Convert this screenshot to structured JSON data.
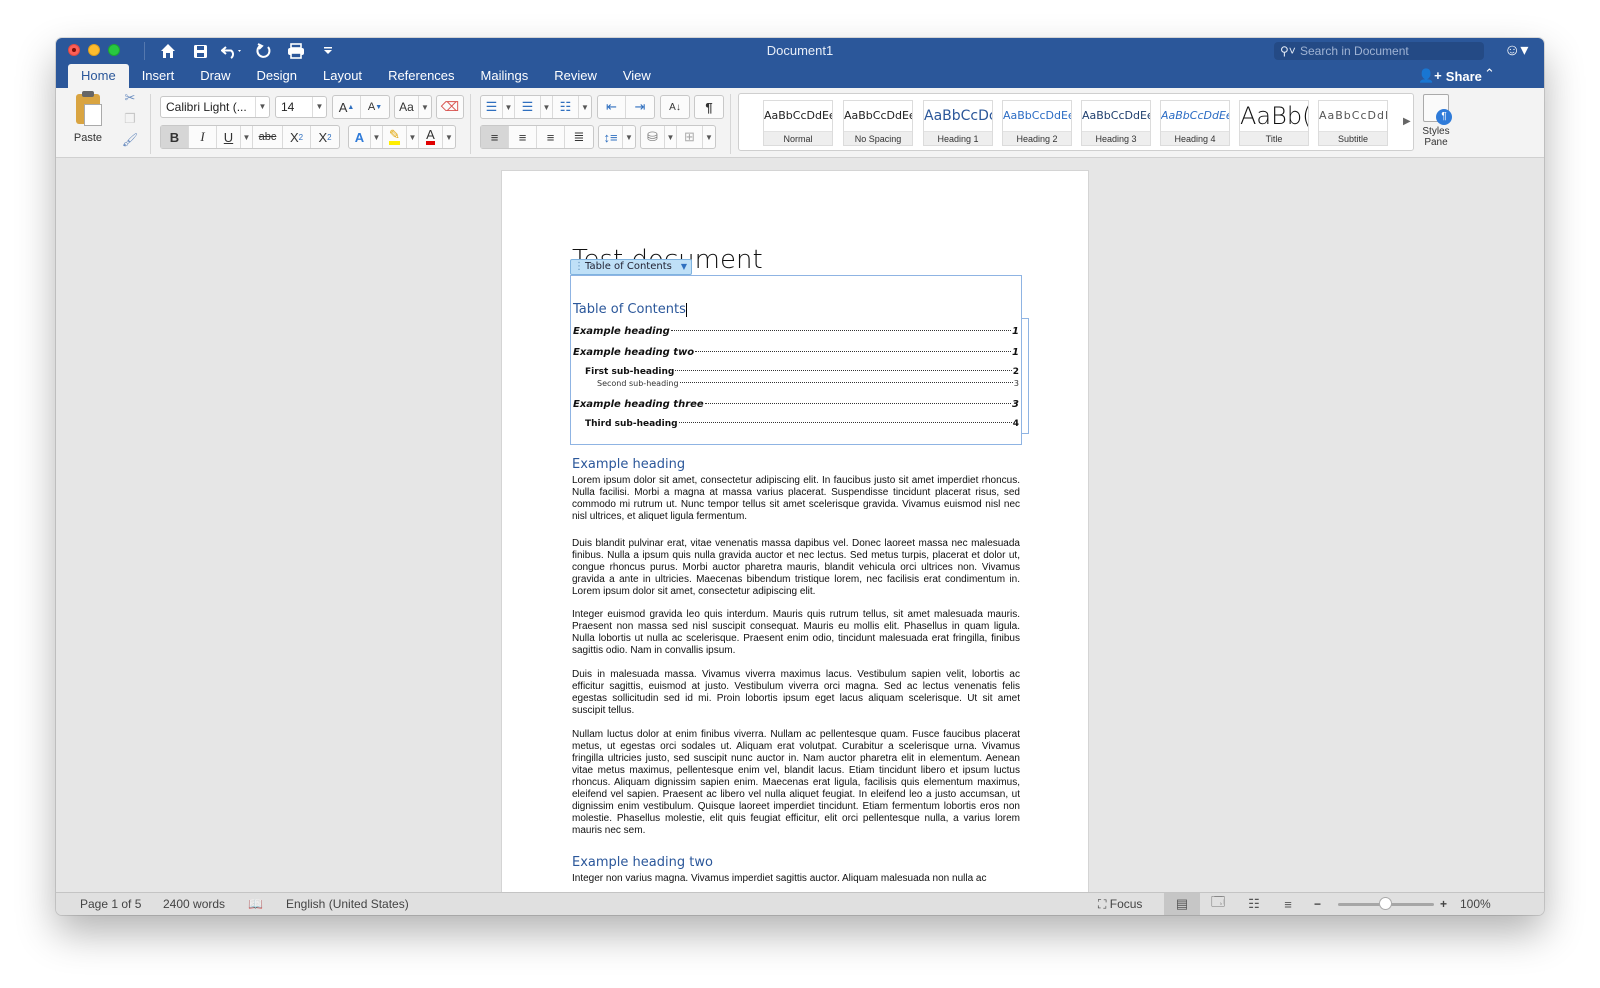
{
  "window": {
    "title": "Document1",
    "search_placeholder": "Search in Document"
  },
  "quick_access": [
    {
      "icon": "home-icon",
      "glyph": "⌂"
    },
    {
      "icon": "save-icon",
      "glyph": "💾"
    },
    {
      "icon": "undo-icon",
      "glyph": "↶"
    },
    {
      "icon": "redo-icon",
      "glyph": "↺"
    },
    {
      "icon": "print-icon",
      "glyph": "⎙"
    },
    {
      "icon": "customize-icon",
      "glyph": "▾"
    }
  ],
  "tabs": [
    {
      "label": "Home",
      "active": true
    },
    {
      "label": "Insert"
    },
    {
      "label": "Draw"
    },
    {
      "label": "Design"
    },
    {
      "label": "Layout"
    },
    {
      "label": "References"
    },
    {
      "label": "Mailings"
    },
    {
      "label": "Review"
    },
    {
      "label": "View"
    }
  ],
  "share_label": "Share",
  "ribbon": {
    "paste_label": "Paste",
    "font_name": "Calibri Light (...",
    "font_size": "14",
    "styles": [
      {
        "sample": "AaBbCcDdEe",
        "name": "Normal",
        "color": "#222222"
      },
      {
        "sample": "AaBbCcDdEe",
        "name": "No Spacing",
        "color": "#222222"
      },
      {
        "sample": "AaBbCcDc",
        "name": "Heading 1",
        "color": "#2b579a"
      },
      {
        "sample": "AaBbCcDdEe",
        "name": "Heading 2",
        "color": "#2b6cc4"
      },
      {
        "sample": "AaBbCcDdEe",
        "name": "Heading 3",
        "color": "#1f3f6e"
      },
      {
        "sample": "AaBbCcDdEe",
        "name": "Heading 4",
        "color": "#2b6cc4"
      },
      {
        "sample": "AaBb(",
        "name": "Title",
        "color": "#111111"
      },
      {
        "sample": "AaBbCcDdEe",
        "name": "Subtitle",
        "color": "#555555"
      }
    ],
    "styles_pane_label_1": "Styles",
    "styles_pane_label_2": "Pane"
  },
  "document": {
    "title": "Test document",
    "toc_control_label": "Table of Contents",
    "toc_heading": "Table of Contents",
    "toc_entries": [
      {
        "text": "Example heading",
        "page": "1",
        "level": 1
      },
      {
        "text": "Example heading two",
        "page": "1",
        "level": 1
      },
      {
        "text": "First sub-heading",
        "page": "2",
        "level": 2
      },
      {
        "text": "Second sub-heading",
        "page": "3",
        "level": 3
      },
      {
        "text": "Example heading three",
        "page": "3",
        "level": 1
      },
      {
        "text": "Third sub-heading",
        "page": "4",
        "level": 2
      }
    ],
    "heading_1": "Example heading",
    "paragraphs": [
      "Lorem ipsum dolor sit amet, consectetur adipiscing elit. In faucibus justo sit amet imperdiet rhoncus. Nulla facilisi. Morbi a magna at massa varius placerat. Suspendisse tincidunt placerat risus, sed commodo mi rutrum ut. Nunc tempor tellus sit amet scelerisque gravida. Vivamus euismod nisl nec nisl ultrices, et aliquet ligula fermentum.",
      "Duis blandit pulvinar erat, vitae venenatis massa dapibus vel. Donec laoreet massa nec malesuada finibus. Nulla a ipsum quis nulla gravida auctor et nec lectus. Sed metus turpis, placerat et dolor ut, congue rhoncus purus. Morbi auctor pharetra mauris, blandit vehicula orci ultrices non. Vivamus gravida a ante in ultricies. Maecenas bibendum tristique lorem, nec facilisis erat condimentum in. Lorem ipsum dolor sit amet, consectetur adipiscing elit.",
      "Integer euismod gravida leo quis interdum. Mauris quis rutrum tellus, sit amet malesuada mauris. Praesent non massa sed nisl suscipit consequat. Mauris eu mollis elit. Phasellus in quam ligula. Nulla lobortis ut nulla ac scelerisque. Praesent enim odio, tincidunt malesuada erat fringilla, finibus sagittis odio. Nam in convallis ipsum.",
      "Duis in malesuada massa. Vivamus viverra maximus lacus. Vestibulum sapien velit, lobortis ac efficitur sagittis, euismod at justo. Vestibulum viverra orci magna. Sed ac lectus venenatis felis egestas sollicitudin sed id mi. Proin lobortis ipsum eget lacus aliquam scelerisque. Ut sit amet suscipit tellus.",
      "Nullam luctus dolor at enim finibus viverra. Nullam ac pellentesque quam. Fusce faucibus placerat metus, ut egestas orci sodales ut. Aliquam erat volutpat. Curabitur a scelerisque urna. Vivamus fringilla ultricies justo, sed suscipit nunc auctor in. Nam auctor pharetra elit in elementum. Aenean vitae metus maximus, pellentesque enim vel, blandit lacus. Etiam tincidunt libero et ipsum luctus rhoncus. Aliquam dignissim sapien enim. Maecenas erat ligula, facilisis quis elementum maximus, eleifend vel sapien. Praesent ac libero vel nulla aliquet feugiat. In eleifend leo a justo accumsan, ut dignissim enim vestibulum. Quisque laoreet imperdiet tincidunt. Etiam fermentum lobortis eros non molestie. Phasellus molestie, elit quis feugiat efficitur, elit orci pellentesque nulla, a varius lorem mauris nec sem."
    ],
    "heading_2": "Example heading two",
    "paragraph_cut": "Integer non varius magna. Vivamus imperdiet sagittis auctor. Aliquam malesuada non nulla ac"
  },
  "status": {
    "page": "Page 1 of 5",
    "words": "2400 words",
    "language": "English (United States)",
    "focus": "Focus",
    "zoom": "100%",
    "zoom_fraction": 0.5
  }
}
